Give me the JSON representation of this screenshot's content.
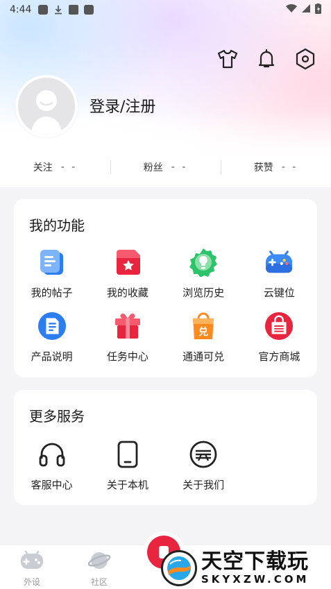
{
  "status_bar": {
    "time": "4:44"
  },
  "profile": {
    "login_text": "登录/注册"
  },
  "stats": [
    {
      "label": "关注",
      "value": "- -"
    },
    {
      "label": "粉丝",
      "value": "- -"
    },
    {
      "label": "获赞",
      "value": "- -"
    }
  ],
  "functions": {
    "title": "我的功能",
    "items": [
      {
        "label": "我的帖子",
        "icon": "posts-icon"
      },
      {
        "label": "我的收藏",
        "icon": "favorites-icon"
      },
      {
        "label": "浏览历史",
        "icon": "history-icon"
      },
      {
        "label": "云键位",
        "icon": "cloud-keymap-icon"
      },
      {
        "label": "产品说明",
        "icon": "manual-icon"
      },
      {
        "label": "任务中心",
        "icon": "gift-icon"
      },
      {
        "label": "通通可兑",
        "icon": "redeem-icon"
      },
      {
        "label": "官方商城",
        "icon": "store-icon"
      }
    ]
  },
  "services": {
    "title": "更多服务",
    "items": [
      {
        "label": "客服中心",
        "icon": "headset-icon"
      },
      {
        "label": "关于本机",
        "icon": "phone-icon"
      },
      {
        "label": "关于我们",
        "icon": "about-icon"
      }
    ]
  },
  "tabbar": {
    "tabs": [
      {
        "label": "外设",
        "icon": "gamepad-icon"
      },
      {
        "label": "社区",
        "icon": "planet-icon"
      }
    ]
  },
  "watermark": {
    "cn": "天空下载玩",
    "en": "SKYXZW.COM"
  },
  "colors": {
    "accent": "#e8243f",
    "background": "#f4f4f6"
  }
}
